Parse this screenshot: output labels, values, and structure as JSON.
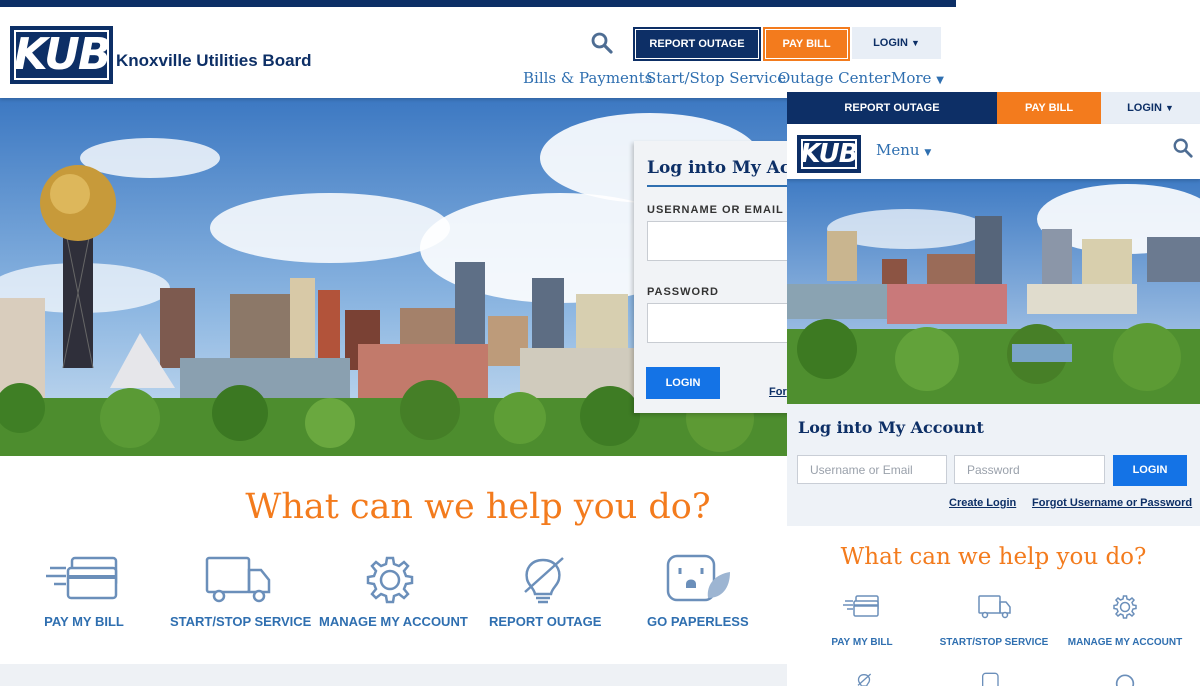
{
  "desktop": {
    "logo_text": "KUB",
    "brand_name": "Knoxville Utilities Board",
    "buttons": {
      "report_outage": "REPORT OUTAGE",
      "pay_bill": "PAY BILL",
      "login": "LOGIN"
    },
    "nav": {
      "bills": "Bills & Payments",
      "start_stop": "Start/Stop Service",
      "outage": "Outage Center",
      "more": "More"
    },
    "login_card": {
      "title": "Log into My Account",
      "username_label": "USERNAME OR EMAIL",
      "password_label": "PASSWORD",
      "button": "LOGIN",
      "forgot": "For"
    },
    "help_title": "What can we help you do?",
    "tiles": [
      "PAY MY BILL",
      "START/STOP SERVICE",
      "MANAGE MY ACCOUNT",
      "REPORT OUTAGE",
      "GO PAPERLESS"
    ]
  },
  "mobile": {
    "buttons": {
      "report_outage": "REPORT OUTAGE",
      "pay_bill": "PAY BILL",
      "login": "LOGIN"
    },
    "logo_text": "KUB",
    "menu": "Menu",
    "login_title": "Log into My Account",
    "username_placeholder": "Username or Email",
    "password_placeholder": "Password",
    "login_button": "LOGIN",
    "create_login": "Create Login",
    "forgot": "Forgot Username or Password",
    "help_title": "What can we help you do?",
    "tiles": [
      "PAY MY BILL",
      "START/STOP SERVICE",
      "MANAGE MY ACCOUNT"
    ]
  },
  "colors": {
    "navy": "#0d2f66",
    "orange": "#f37b1d",
    "blue": "#2f6fb0",
    "button_blue": "#1473e6"
  },
  "icons": [
    "search-icon",
    "credit-card-icon",
    "truck-icon",
    "gear-icon",
    "lightbulb-off-icon",
    "outlet-leaf-icon",
    "caret-down-icon"
  ]
}
